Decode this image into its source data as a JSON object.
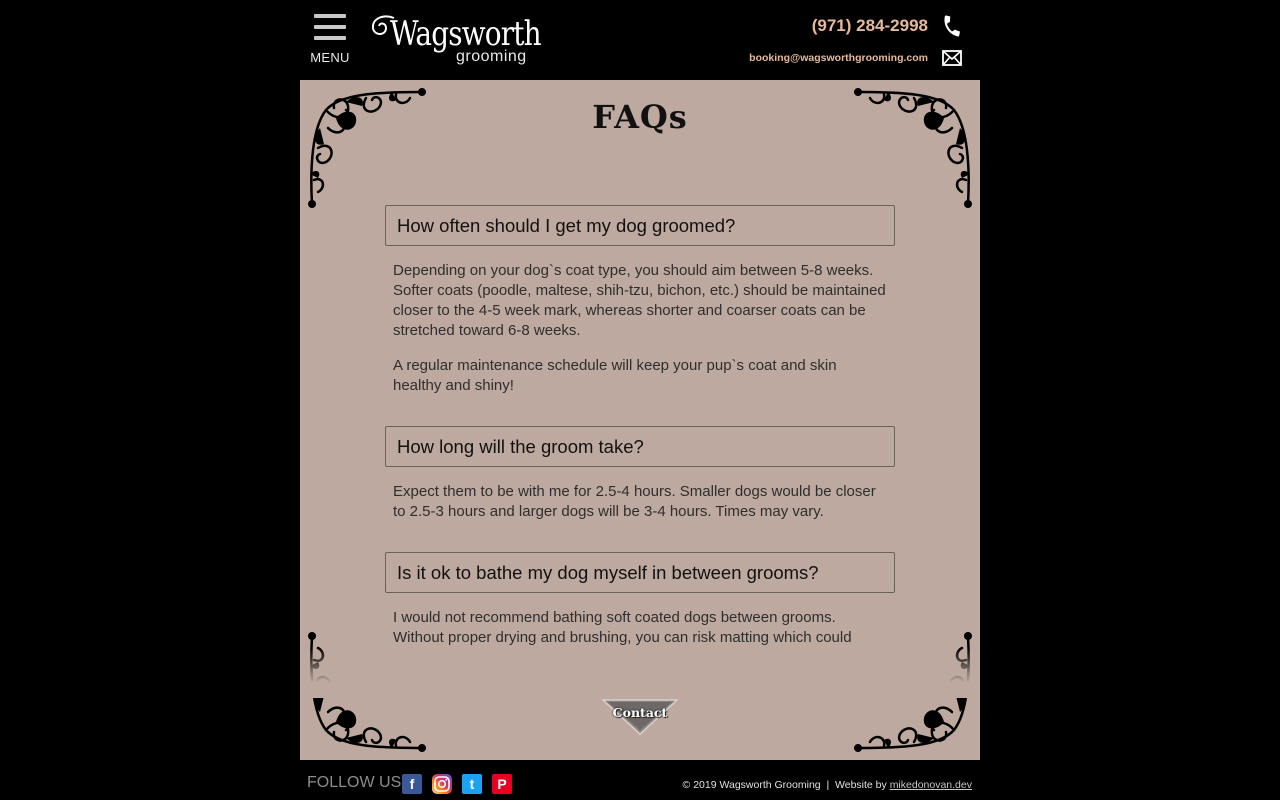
{
  "header": {
    "menu_label": "MENU",
    "logo_main": "Wagsworth",
    "logo_sub": "grooming",
    "phone": "(971) 284-2998",
    "email": "booking@wagsworthgrooming.com"
  },
  "page": {
    "title": "FAQs"
  },
  "faqs": [
    {
      "question": "How often should I get my dog groomed?",
      "answers": [
        "Depending on your dog`s coat type, you should aim between 5-8 weeks. Softer coats (poodle, maltese, shih-tzu, bichon, etc.) should be maintained closer to the 4-5 week mark, whereas shorter and coarser coats can be stretched toward 6-8 weeks.",
        "A regular maintenance schedule will keep your pup`s coat and skin healthy and shiny!"
      ]
    },
    {
      "question": "How long will the groom take?",
      "answers": [
        "Expect them to be with me for 2.5-4 hours. Smaller dogs would be closer to 2.5-3 hours and larger dogs will be 3-4 hours. Times may vary."
      ]
    },
    {
      "question": "Is it ok to bathe my dog myself in between grooms?",
      "answers": [
        "I would not recommend bathing soft coated dogs between grooms. Without proper drying and brushing, you can risk matting which could"
      ]
    }
  ],
  "contact_button": {
    "label": "Contact"
  },
  "footer": {
    "follow_label": "FOLLOW US",
    "copyright": "© 2019 Wagsworth Grooming  |  Website by ",
    "dev_link": "mikedonovan.dev",
    "social": {
      "facebook": "f",
      "twitter": "t",
      "pinterest": "P"
    }
  },
  "colors": {
    "accent": "#e6b99d",
    "content_bg": "#bda99f",
    "facebook": "#3b5998",
    "twitter": "#1da1f2",
    "pinterest": "#e60023"
  },
  "icons": {
    "phone": "phone-icon",
    "email": "envelope-icon",
    "menu": "hamburger-icon"
  }
}
